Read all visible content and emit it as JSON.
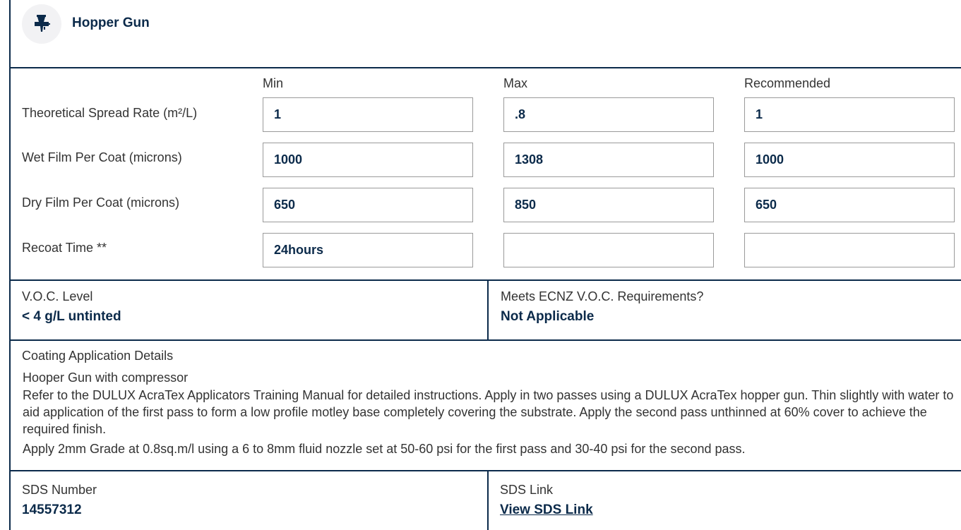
{
  "header": {
    "title": "Hopper Gun",
    "icon": "spray-gun-icon"
  },
  "spec_table": {
    "columns": [
      "Min",
      "Max",
      "Recommended"
    ],
    "rows": [
      {
        "label": "Theoretical Spread Rate (m²/L)",
        "values": [
          "1",
          ".8",
          "1"
        ]
      },
      {
        "label": "Wet Film Per Coat (microns)",
        "values": [
          "1000",
          "1308",
          "1000"
        ]
      },
      {
        "label": "Dry Film Per Coat (microns)",
        "values": [
          "650",
          "850",
          "650"
        ]
      },
      {
        "label": "Recoat Time **",
        "values": [
          "24hours",
          "",
          ""
        ]
      }
    ]
  },
  "voc": {
    "label": "V.O.C. Level",
    "value": "< 4 g/L untinted"
  },
  "ecnz": {
    "label": "Meets ECNZ V.O.C. Requirements?",
    "value": "Not Applicable"
  },
  "coating": {
    "label": "Coating Application Details",
    "lines": [
      "Hooper Gun with compressor",
      "Refer to the DULUX AcraTex Applicators Training Manual for detailed instructions. Apply in two passes using a DULUX AcraTex hopper gun. Thin slightly with water to aid application of the first pass to form a low profile motley base completely covering the substrate. Apply the second pass unthinned at 60% cover to achieve the required finish.",
      "Apply 2mm Grade at 0.8sq.m/l using a 6 to 8mm fluid nozzle set at 50-60 psi for the first pass and 30-40 psi for the second pass."
    ]
  },
  "sds": {
    "label": "SDS Number",
    "value": "14557312"
  },
  "sds_link": {
    "label": "SDS Link",
    "value": "View SDS Link"
  },
  "colors": {
    "navy": "#0b2a4a",
    "border": "#9a9a9a"
  }
}
